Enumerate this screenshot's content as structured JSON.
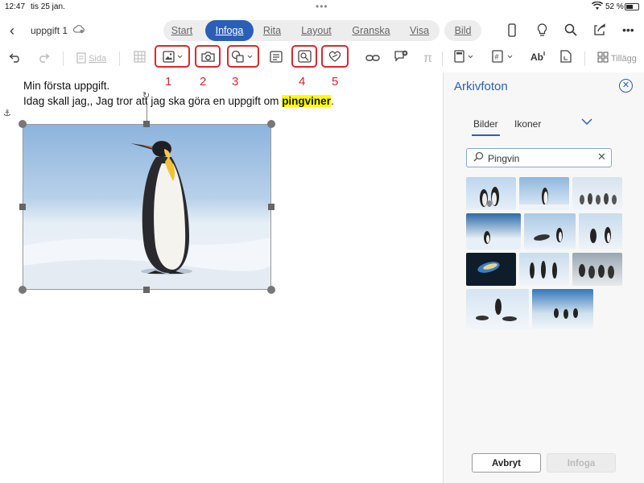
{
  "statusbar": {
    "time": "12:47",
    "date": "tis 25 jan.",
    "battery": "52 %",
    "dots": "•••"
  },
  "titlebar": {
    "back": "‹",
    "doc_title": "uppgift 1",
    "tabs": [
      "Start",
      "Infoga",
      "Rita",
      "Layout",
      "Granska",
      "Visa"
    ],
    "active_tab": "Infoga",
    "picture_tab": "Bild"
  },
  "ribbon": {
    "page_label": "Sida",
    "annotations": [
      "1",
      "2",
      "3",
      "4",
      "5"
    ],
    "addins_label": "Tillägg",
    "highlight_color": "#e0262e"
  },
  "document": {
    "line1": "Min första uppgift.",
    "line2_before": "Idag skall jag,, Jag tror att jag ska göra en uppgift om ",
    "line2_highlight": "pingviner",
    "line2_after": "."
  },
  "panel": {
    "title": "Arkivfoton",
    "tab_images": "Bilder",
    "tab_icons": "Ikoner",
    "search_value": "Pingvin",
    "cancel_button": "Avbryt",
    "insert_button": "Infoga",
    "accent": "#2b5fb7"
  }
}
